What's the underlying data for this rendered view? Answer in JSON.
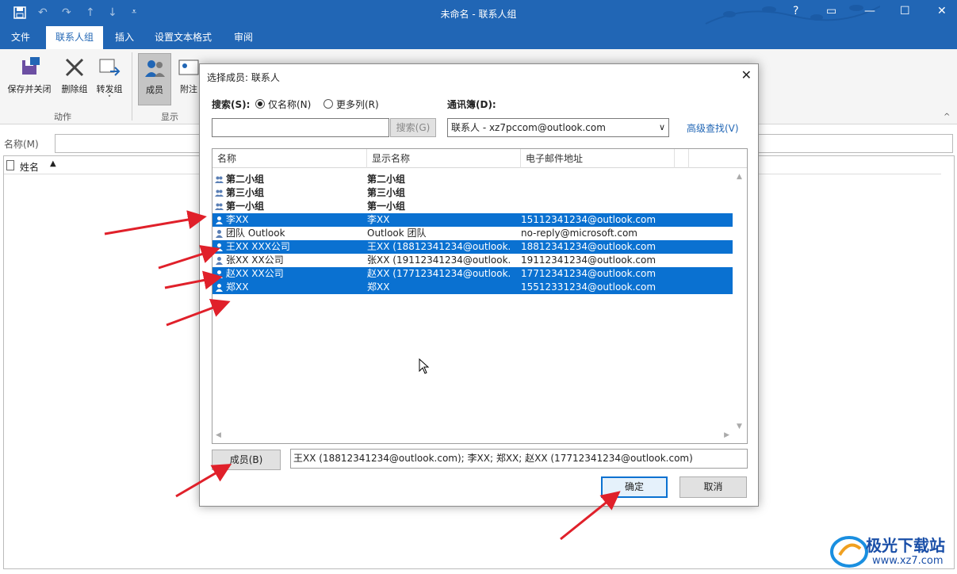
{
  "window": {
    "title": "未命名  -  联系人组",
    "help": "?",
    "ribbon_toggle": "▭",
    "minimize": "—",
    "maximize": "☐",
    "close": "✕"
  },
  "quick_access": [
    "save-icon",
    "undo-icon",
    "redo-icon",
    "up-icon",
    "down-icon",
    "customize-icon"
  ],
  "tabs": [
    {
      "label": "文件"
    },
    {
      "label": "联系人组"
    },
    {
      "label": "插入"
    },
    {
      "label": "设置文本格式"
    },
    {
      "label": "审阅"
    }
  ],
  "ribbon": {
    "save_close": "保存并关闭",
    "delete_group": "删除组",
    "forward_group": "转发组",
    "forward_caret": "˅",
    "group_actions": "动作",
    "members": "成员",
    "notes": "附注",
    "group_show": "显示",
    "collapse": "^"
  },
  "contact_form": {
    "name_label": "名称(M)",
    "name_value": "",
    "col_name": "姓名",
    "sort_icon": "▲"
  },
  "dialog": {
    "title": "选择成员: 联系人",
    "close": "✕",
    "search_label": "搜索(S):",
    "radio_name_only": "仅名称(N)",
    "radio_more_cols": "更多列(R)",
    "search_value": "",
    "search_button": "搜索(G)",
    "addressbook_label": "通讯簿(D):",
    "addressbook_value": "联系人 - xz7pccom@outlook.com",
    "advanced_find": "高级查找(V)",
    "columns": [
      "名称",
      "显示名称",
      "电子邮件地址"
    ],
    "rows": [
      {
        "name": "第二小组",
        "display": "第二小组",
        "email": "",
        "type": "group",
        "selected": false
      },
      {
        "name": "第三小组",
        "display": "第三小组",
        "email": "",
        "type": "group",
        "selected": false
      },
      {
        "name": "第一小组",
        "display": "第一小组",
        "email": "",
        "type": "group",
        "selected": false
      },
      {
        "name": "李XX",
        "display": "李XX",
        "email": "15112341234@outlook.com",
        "type": "person",
        "selected": true
      },
      {
        "name": "团队 Outlook",
        "display": "Outlook 团队",
        "email": "no-reply@microsoft.com",
        "type": "person",
        "selected": false
      },
      {
        "name": "王XX XXX公司",
        "display": "王XX (18812341234@outlook.c...",
        "email": "18812341234@outlook.com",
        "type": "person",
        "selected": true
      },
      {
        "name": "张XX XX公司",
        "display": "张XX (19112341234@outlook.c...",
        "email": "19112341234@outlook.com",
        "type": "person",
        "selected": false
      },
      {
        "name": "赵XX XX公司",
        "display": "赵XX (17712341234@outlook.c...",
        "email": "17712341234@outlook.com",
        "type": "person",
        "selected": true
      },
      {
        "name": "郑XX",
        "display": "郑XX",
        "email": "15512331234@outlook.com",
        "type": "person",
        "selected": true
      }
    ],
    "members_button": "成员(B)",
    "members_value": "王XX (18812341234@outlook.com); 李XX; 郑XX; 赵XX (17712341234@outlook.com)",
    "ok_button": "确定",
    "cancel_button": "取消"
  },
  "watermark": {
    "brand": "极光下载站",
    "url": "www.xz7.com"
  },
  "colors": {
    "title_bar": "#2166b5",
    "selection": "#0a71d1",
    "arrow": "#e0202a"
  }
}
